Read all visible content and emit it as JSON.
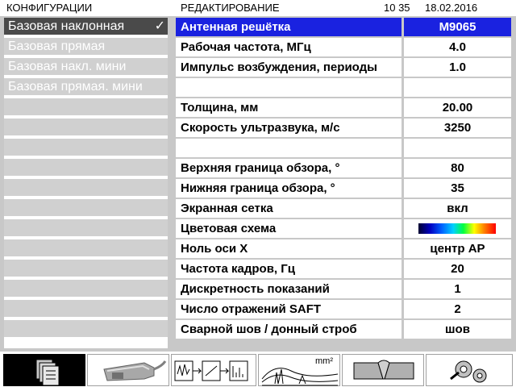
{
  "header": {
    "section": "КОНФИГУРАЦИИ",
    "mode": "РЕДАКТИРОВАНИЕ",
    "time": "10 35",
    "date": "18.02.2016"
  },
  "configs": [
    {
      "label": "Базовая наклонная",
      "state": "selected"
    },
    {
      "label": "Базовая прямая",
      "state": "dim"
    },
    {
      "label": "Базовая накл. мини",
      "state": "dim"
    },
    {
      "label": "Базовая прямая. мини",
      "state": "dim"
    },
    {
      "label": ""
    },
    {
      "label": ""
    },
    {
      "label": ""
    },
    {
      "label": ""
    },
    {
      "label": ""
    },
    {
      "label": ""
    },
    {
      "label": ""
    },
    {
      "label": ""
    },
    {
      "label": ""
    },
    {
      "label": ""
    },
    {
      "label": ""
    },
    {
      "label": ""
    }
  ],
  "check_mark": "✓",
  "params": [
    {
      "label": "Антенная решётка",
      "value": "M9065"
    },
    {
      "label": "Рабочая частота, МГц",
      "value": "4.0"
    },
    {
      "label": "Импульс возбуждения, периоды",
      "value": "1.0"
    },
    {
      "label": "",
      "value": ""
    },
    {
      "label": "Толщина, мм",
      "value": "20.00"
    },
    {
      "label": "Скорость ультразвука, м/с",
      "value": "3250"
    },
    {
      "label": "",
      "value": ""
    },
    {
      "label": "Верхняя граница обзора, °",
      "value": "80"
    },
    {
      "label": "Нижняя граница обзора, °",
      "value": "35"
    },
    {
      "label": "Экранная сетка",
      "value": "вкл"
    },
    {
      "label": "Цветовая схема",
      "value": ""
    },
    {
      "label": "Ноль оси X",
      "value": "центр АР"
    },
    {
      "label": "Частота кадров, Гц",
      "value": "20"
    },
    {
      "label": "Дискретность показаний",
      "value": "1"
    },
    {
      "label": "Число отражений SAFT",
      "value": "2"
    },
    {
      "label": "Сварной шов / донный строб",
      "value": "шов"
    }
  ],
  "colors": {
    "active_row": "#1a22e0",
    "panel": "#c8c8c8",
    "selected_config": "#4a4a4a"
  },
  "toolbar": {
    "icons": [
      "documents-icon",
      "probe-icon",
      "signal-chain-icon",
      "waveform-area-icon",
      "weld-icon",
      "settings-gears-icon"
    ],
    "area_unit": "mm²"
  }
}
